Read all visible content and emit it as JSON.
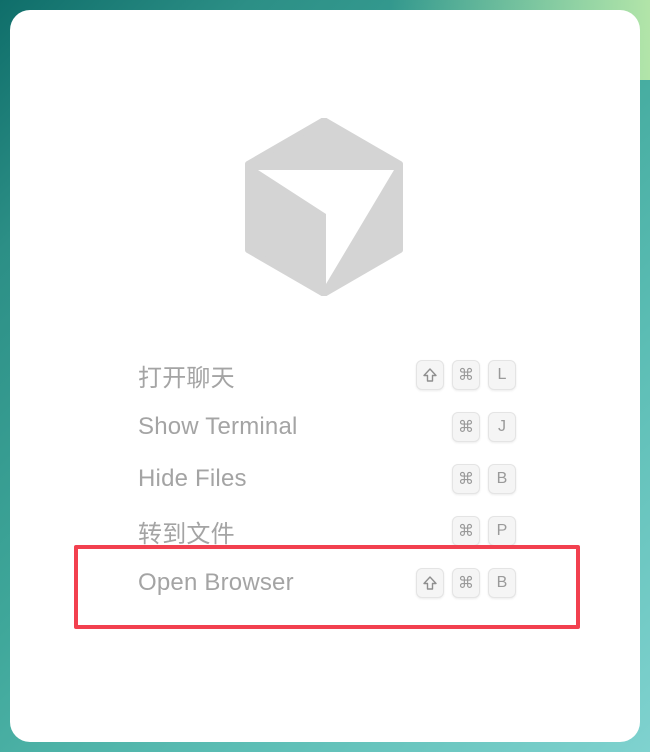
{
  "logo": {
    "icon": "cube-logo-icon",
    "color": "#d0d0d0"
  },
  "shortcuts": [
    {
      "label": "打开聊天",
      "keys": [
        "shift",
        "cmd",
        "L"
      ]
    },
    {
      "label": "Show Terminal",
      "keys": [
        "cmd",
        "J"
      ]
    },
    {
      "label": "Hide Files",
      "keys": [
        "cmd",
        "B"
      ]
    },
    {
      "label": "转到文件",
      "keys": [
        "cmd",
        "P"
      ]
    },
    {
      "label": "Open Browser",
      "keys": [
        "shift",
        "cmd",
        "B"
      ]
    }
  ],
  "keycaps": {
    "L": "L",
    "J": "J",
    "B": "B",
    "P": "P",
    "cmd_glyph": "⌘"
  },
  "highlight": {
    "target": "Open Browser",
    "color": "#f2404f"
  }
}
